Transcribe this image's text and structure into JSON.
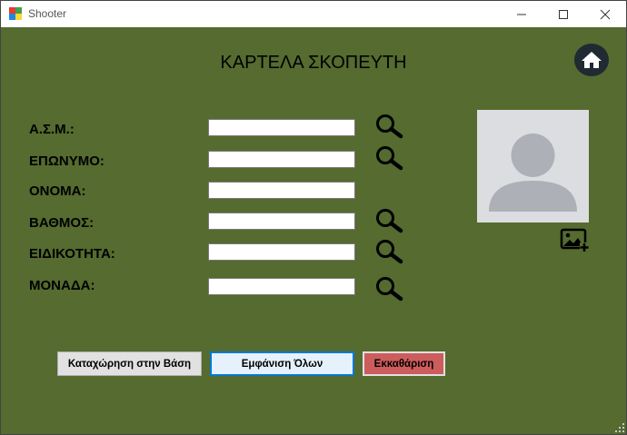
{
  "window": {
    "title": "Shooter",
    "controls": {
      "minimize": "–",
      "maximize": "☐",
      "close": "✕"
    }
  },
  "page": {
    "heading": "ΚΑΡΤΕΛΑ ΣΚΟΠΕΥΤΗ"
  },
  "form": {
    "fields": [
      {
        "label": "Α.Σ.Μ.:",
        "value": "",
        "searchable": true
      },
      {
        "label": "ΕΠΩΝΥΜΟ:",
        "value": "",
        "searchable": true
      },
      {
        "label": "ΟΝΟΜΑ:",
        "value": "",
        "searchable": false
      },
      {
        "label": "ΒΑΘΜΟΣ:",
        "value": "",
        "searchable": true
      },
      {
        "label": "ΕΙΔΙΚΟΤΗΤΑ:",
        "value": "",
        "searchable": true
      },
      {
        "label": "ΜΟΝΑΔΑ:",
        "value": "",
        "searchable": true
      }
    ]
  },
  "buttons": {
    "save": "Καταχώρηση στην Βάση",
    "show_all": "Εμφάνιση Όλων",
    "clear": "Εκκαθάριση"
  },
  "icons": {
    "home": "home-icon",
    "search": "magnifier-icon",
    "avatar": "user-placeholder-icon",
    "add_photo": "add-image-icon"
  },
  "colors": {
    "background": "#556b2f",
    "clear_button": "#cd5c5c",
    "home_button": "#1f2a33"
  }
}
